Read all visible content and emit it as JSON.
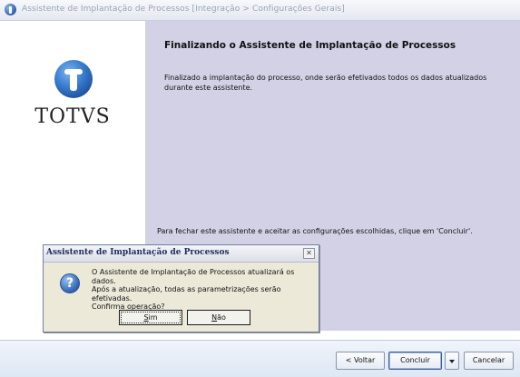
{
  "window": {
    "title": "Assistente de Implantação de Processos [Integração > Configurações Gerais]",
    "icon": "totvs-app-icon"
  },
  "logo": {
    "wordmark": "TOTVS",
    "icon": "totvs-globe-logo",
    "brand_color": "#2a66b8"
  },
  "panel": {
    "heading": "Finalizando o Assistente de Implantação de Processos",
    "body": "Finalizado a implantação do processo, onde serão efetivados todos os dados atualizados durante este assistente.",
    "close_instruction": "Para fechar este assistente e aceitar as configurações escolhidas, clique em 'Concluir'.",
    "background": "#d3d1e6"
  },
  "buttons": {
    "back": "< Voltar",
    "finish": "Concluir",
    "cancel": "Cancelar"
  },
  "dialog": {
    "title": "Assistente de Implantação de Processos",
    "icon": "question-icon",
    "message_lines": [
      "O Assistente de Implantação de Processos atualizará os dados.",
      "Após a atualização, todas as parametrizações serão efetivadas.",
      "Confirma operação?"
    ],
    "yes_first": "S",
    "yes_rest": "im",
    "no_first": "N",
    "no_rest": "ão"
  }
}
